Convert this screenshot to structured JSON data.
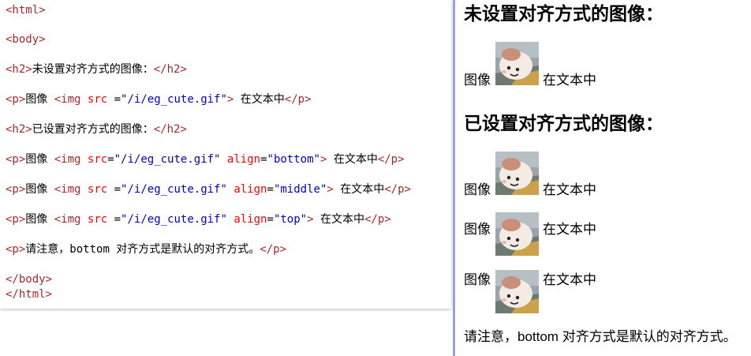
{
  "code": {
    "lines": [
      {
        "tag_open": "<html>"
      },
      {
        "tag_open": "<body>"
      },
      {
        "tag_open": "<h2>",
        "text": "未设置对齐方式的图像：",
        "tag_close": "</h2>"
      },
      {
        "tag_open": "<p>",
        "text": "图像 ",
        "img_open": "<img",
        "attr1": "src",
        "eq1": " =",
        "val1": "\"/i/eg_cute.gif\"",
        "img_close": ">",
        "text2": " 在文本中",
        "tag_close": "</p>"
      },
      {
        "tag_open": "<h2>",
        "text": "已设置对齐方式的图像：",
        "tag_close": "</h2>"
      },
      {
        "tag_open": "<p>",
        "text": "图像 ",
        "img_open": "<img",
        "attr1": "src",
        "eq1": "=",
        "val1": "\"/i/eg_cute.gif\"",
        "attr2": "align",
        "eq2": "=",
        "val2": "\"bottom\"",
        "img_close": ">",
        "text2": " 在文本中",
        "tag_close": "</p>"
      },
      {
        "tag_open": "<p>",
        "text": "图像 ",
        "img_open": "<img",
        "attr1": "src",
        "eq1": " =",
        "val1": "\"/i/eg_cute.gif\"",
        "attr2": "align",
        "eq2": "=",
        "val2": "\"middle\"",
        "img_close": ">",
        "text2": " 在文本中",
        "tag_close": "</p>"
      },
      {
        "tag_open": "<p>",
        "text": "图像 ",
        "img_open": "<img",
        "attr1": "src",
        "eq1": " =",
        "val1": "\"/i/eg_cute.gif\"",
        "attr2": "align",
        "eq2": "=",
        "val2": "\"top\"",
        "img_close": ">",
        "text2": " 在文本中",
        "tag_close": "</p>"
      },
      {
        "tag_open": "<p>",
        "text": "请注意，bottom 对齐方式是默认的对齐方式。",
        "tag_close": "</p>"
      },
      {
        "tag_open": "</body>"
      },
      {
        "tag_open": "</html>"
      }
    ]
  },
  "result": {
    "heading1": "未设置对齐方式的图像：",
    "heading2": "已设置对齐方式的图像：",
    "p1": {
      "before": "图像",
      "after": "在文本中"
    },
    "p_bottom": {
      "before": "图像",
      "after": "在文本中"
    },
    "p_middle": {
      "before": "图像",
      "after": "在文本中"
    },
    "p_top": {
      "before": "图像",
      "after": "在文本中"
    },
    "note": "请注意，bottom 对齐方式是默认的对齐方式。"
  },
  "colors": {
    "tag": "#a52a2a",
    "attribute": "#ff0000",
    "value": "#0000cd",
    "divider": "#7b82e6"
  }
}
